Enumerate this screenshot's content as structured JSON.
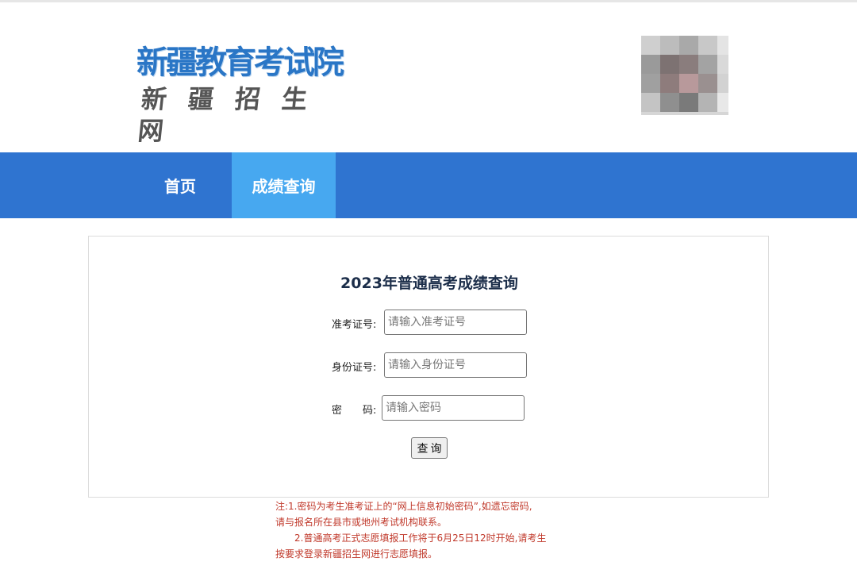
{
  "header": {
    "logo_line1": "新疆教育考试院",
    "logo_line2": "新疆招生网"
  },
  "nav": {
    "items": [
      {
        "label": "首页"
      },
      {
        "label": "成绩查询"
      }
    ],
    "active_index": 1
  },
  "form": {
    "title": "2023年普通高考成绩查询",
    "fields": [
      {
        "label": "准考证号:",
        "placeholder": "请输入准考证号",
        "value": ""
      },
      {
        "label": "身份证号:",
        "placeholder": "请输入身份证号",
        "value": ""
      },
      {
        "label": "密　　码:",
        "placeholder": "请输入密码",
        "value": ""
      }
    ],
    "submit_label": "查询"
  },
  "notes": {
    "lines": [
      "注:1.密码为考生准考证上的“网上信息初始密码”,如遗忘密码,",
      "请与报名所在县市或地州考试机构联系。",
      "　　2.普通高考正式志愿填报工作将于6月25日12时开始,请考生",
      "按要求登录新疆招生网进行志愿填报。"
    ]
  },
  "colors": {
    "nav_bg": "#2f74d0",
    "nav_active_bg": "#47a8f0",
    "logo_blue": "#2a76c6",
    "note_red": "#c0392b"
  }
}
